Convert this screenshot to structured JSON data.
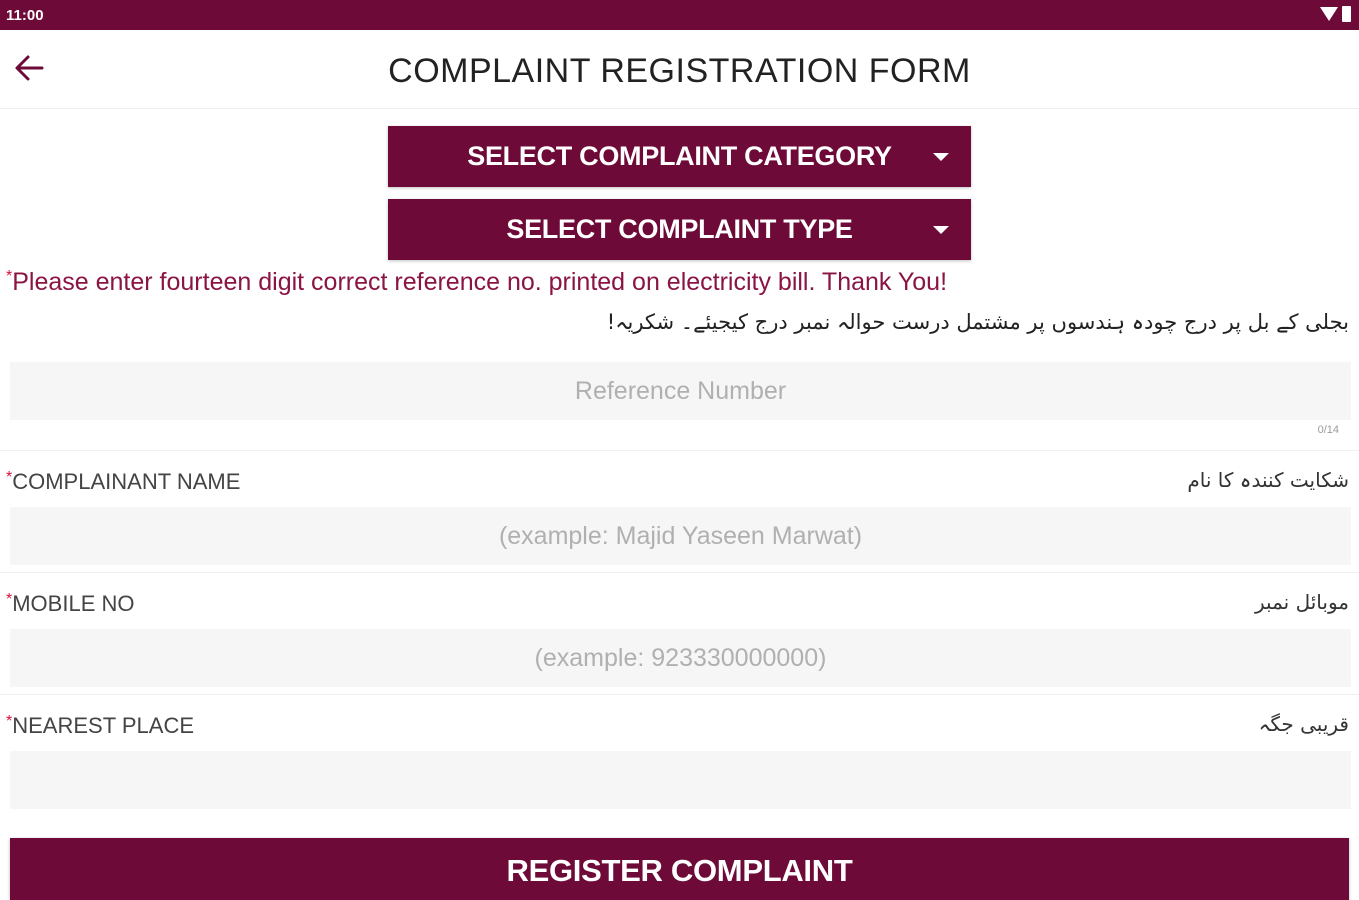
{
  "status_bar": {
    "time": "11:00",
    "icons": [
      "wifi-icon",
      "battery-icon"
    ]
  },
  "header": {
    "title": "COMPLAINT REGISTRATION FORM",
    "back_icon": "arrow-left-icon"
  },
  "dropdowns": {
    "category": "SELECT COMPLAINT CATEGORY",
    "type": "SELECT COMPLAINT TYPE"
  },
  "notice": {
    "english": "Please enter fourteen digit correct reference no. printed on electricity bill. Thank You!",
    "urdu": "بجلی کے بل پر درج چودہ ہندسوں پر مشتمل درست حوالہ نمبر درج کیجیئے۔ شکریہ!"
  },
  "fields": {
    "reference": {
      "placeholder": "Reference Number",
      "value": "",
      "counter": "0/14"
    },
    "name": {
      "label": "COMPLAINANT NAME",
      "label_ur": "شکایت کنندہ کا نام",
      "placeholder": "(example: Majid Yaseen Marwat)",
      "value": ""
    },
    "mobile": {
      "label": "MOBILE NO",
      "label_ur": "موبائل نمبر",
      "placeholder": "(example: 923330000000)",
      "value": ""
    },
    "place": {
      "label": "NEAREST PLACE",
      "label_ur": "قریبی جگہ",
      "placeholder": "",
      "value": ""
    }
  },
  "required_marker": "*",
  "submit_label": "REGISTER COMPLAINT",
  "colors": {
    "primary": "#6e0a38",
    "required": "#d8103e",
    "notice": "#8a1443"
  }
}
